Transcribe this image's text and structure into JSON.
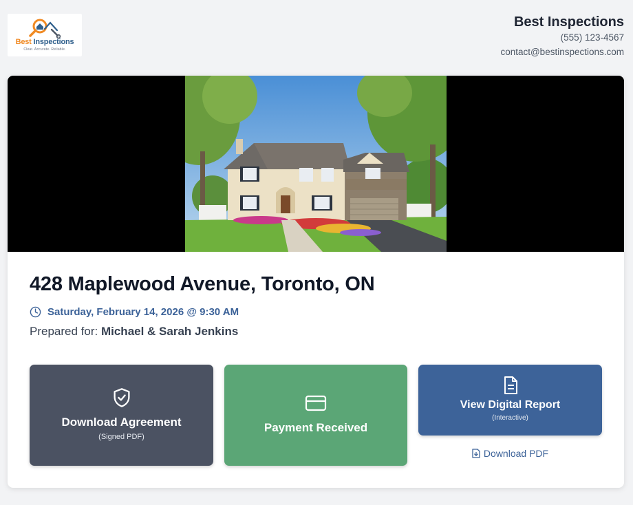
{
  "header": {
    "logo": {
      "name_part1": "Best",
      "name_part2": " Inspections",
      "tagline": "Clear. Accurate. Reliable."
    },
    "company_name": "Best Inspections",
    "phone": "(555) 123-4567",
    "email": "contact@bestinspections.com"
  },
  "property": {
    "address": "428 Maplewood Avenue, Toronto, ON",
    "datetime": "Saturday, February 14, 2026 @ 9:30 AM",
    "prepared_label": "Prepared for:",
    "prepared_for": "Michael & Sarah Jenkins"
  },
  "actions": {
    "agreement": {
      "label": "Download Agreement",
      "sub": "(Signed PDF)",
      "icon": "shield-check-icon",
      "color": "#4b5262"
    },
    "payment": {
      "label": "Payment Received",
      "icon": "credit-card-icon",
      "color": "#5ba676"
    },
    "report": {
      "label": "View Digital Report",
      "sub": "(Interactive)",
      "icon": "document-icon",
      "color": "#3d6399"
    },
    "download_pdf": {
      "label": "Download PDF",
      "icon": "file-download-icon"
    }
  },
  "colors": {
    "accent": "#3d6399",
    "brand_orange": "#f08a24",
    "background": "#f2f3f5"
  }
}
